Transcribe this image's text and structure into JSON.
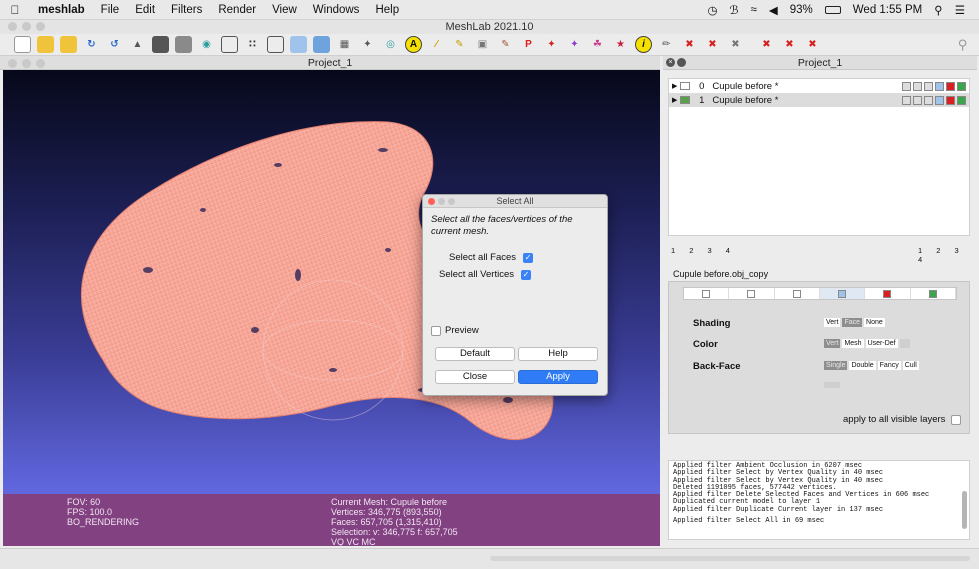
{
  "menubar": {
    "app_name": "meshlab",
    "menus": [
      "File",
      "Edit",
      "Filters",
      "Render",
      "View",
      "Windows",
      "Help"
    ],
    "battery": "93%",
    "clock": "Wed 1:55 PM"
  },
  "window": {
    "title": "MeshLab 2021.10"
  },
  "viewport": {
    "title": "Project_1"
  },
  "side_panel": {
    "title": "Project_1"
  },
  "hud": {
    "fov": "FOV: 60",
    "fps": "FPS:  100.0",
    "mode": "BO_RENDERING",
    "current_mesh": "Current Mesh: Cupule before",
    "vertices": "Vertices: 346,775    (893,550)",
    "faces": "Faces: 657,705    (1,315,410)",
    "selection": "Selection: v: 346,775 f: 657,705",
    "flags": "VQ VC MC"
  },
  "dialog": {
    "title": "Select All",
    "description": "Select all the faces/vertices of the current mesh.",
    "select_faces_label": "Select all Faces",
    "select_faces_checked": true,
    "select_vertices_label": "Select all Vertices",
    "select_vertices_checked": true,
    "preview_label": "Preview",
    "preview_checked": false,
    "default_button": "Default",
    "help_button": "Help",
    "close_button": "Close",
    "apply_button": "Apply"
  },
  "layers": [
    {
      "index": "0",
      "name": "Cupule before *",
      "selected": false
    },
    {
      "index": "1",
      "name": "Cupule before *",
      "selected": true
    }
  ],
  "layer_pages_left": "1 2 3 4",
  "layer_pages_right": "1 2 3 4",
  "render_panel": {
    "layer_label": "Cupule before.obj_copy",
    "shading_label": "Shading",
    "shading_options": [
      "Vert",
      "Face",
      "None"
    ],
    "shading_selected": "Face",
    "color_label": "Color",
    "color_options": [
      "Vert",
      "Mesh",
      "User-Def"
    ],
    "color_selected": "Vert",
    "backface_label": "Back-Face",
    "backface_options": [
      "Single",
      "Double",
      "Fancy",
      "Cull"
    ],
    "backface_selected": "Single",
    "apply_all_label": "apply to all visible layers"
  },
  "log": [
    "Applied filter Ambient Occlusion in 6207 msec",
    "Applied filter Select by Vertex Quality in 40 msec",
    "Applied filter Select by Vertex Quality in 40 msec",
    "Deleted 1191095 faces, 577442 vertices.",
    "Applied filter Delete Selected Faces and Vertices in 606 msec",
    "Duplicated current model to layer 1",
    "Applied filter Duplicate Current layer in 137 msec",
    "",
    "Applied filter Select All in 69 msec"
  ],
  "colors": {
    "mesh": "#f59d8e",
    "hud_bg": "#843e78",
    "accent": "#2f7cf6"
  }
}
